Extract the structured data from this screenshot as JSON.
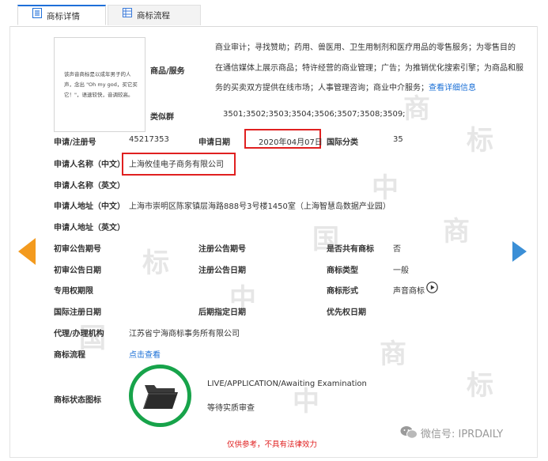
{
  "tabs": [
    {
      "label": "商标详情",
      "active": true
    },
    {
      "label": "商标流程",
      "active": false
    }
  ],
  "preview": {
    "lines": [
      "该声音商标是以成年男子的人",
      "声，念出 \"Oh my god，买它买",
      "它！\"，语速较快，音调较高。"
    ]
  },
  "goods": {
    "label": "商品/服务",
    "lines": [
      "商业审计；寻找赞助；药用、兽医用、卫生用制剂和医疗用品的零售服务；为零售目的",
      "在通信媒体上展示商品；特许经营的商业管理；广告；为推销优化搜索引擎；为商品和服",
      "务的买卖双方提供在线市场；人事管理咨询；商业中介服务；"
    ],
    "more_link": "查看详细信息"
  },
  "similar": {
    "label": "类似群",
    "value": "3501;3502;3503;3504;3506;3507;3508;3509;"
  },
  "reg_no": {
    "label": "申请/注册号",
    "value": "45217353"
  },
  "app_date": {
    "label": "申请日期",
    "value": "2020年04月07日"
  },
  "intl_class": {
    "label": "国际分类",
    "value": "35"
  },
  "applicant_cn": {
    "label": "申请人名称（中文）",
    "value": "上海攸佳电子商务有限公司"
  },
  "applicant_en": {
    "label": "申请人名称（英文）",
    "value": ""
  },
  "address_cn": {
    "label": "申请人地址（中文）",
    "value": "上海市崇明区陈家镇层海路888号3号楼1450室（上海智慧岛数据产业园）"
  },
  "address_en": {
    "label": "申请人地址（英文）",
    "value": ""
  },
  "prelim_issue": {
    "label": "初审公告期号",
    "value": ""
  },
  "reg_issue": {
    "label": "注册公告期号",
    "value": ""
  },
  "shared": {
    "label": "是否共有商标",
    "value": "否"
  },
  "prelim_date": {
    "label": "初审公告日期",
    "value": ""
  },
  "reg_date": {
    "label": "注册公告日期",
    "value": ""
  },
  "mark_type": {
    "label": "商标类型",
    "value": "一般"
  },
  "exclusive": {
    "label": "专用权期限",
    "value": ""
  },
  "mark_form": {
    "label": "商标形式",
    "value": "声音商标"
  },
  "intl_reg_date": {
    "label": "国际注册日期",
    "value": ""
  },
  "later_date": {
    "label": "后期指定日期",
    "value": ""
  },
  "priority_date": {
    "label": "优先权日期",
    "value": ""
  },
  "agent": {
    "label": "代理/办理机构",
    "value": "江苏省宁海商标事务所有限公司"
  },
  "flow": {
    "label": "商标流程",
    "link": "点击查看"
  },
  "status": {
    "label": "商标状态图标",
    "en": "LIVE/APPLICATION/Awaiting Examination",
    "cn": "等待实质审查"
  },
  "disclaimer": "仅供参考，不具有法律效力",
  "wechat": "微信号: IPRDAILY",
  "colors": {
    "accent": "#1e6fd9",
    "highlight": "#e02020",
    "status": "#17a34a",
    "arrow_left": "#f39a1e",
    "arrow_right": "#3b8fd6"
  }
}
